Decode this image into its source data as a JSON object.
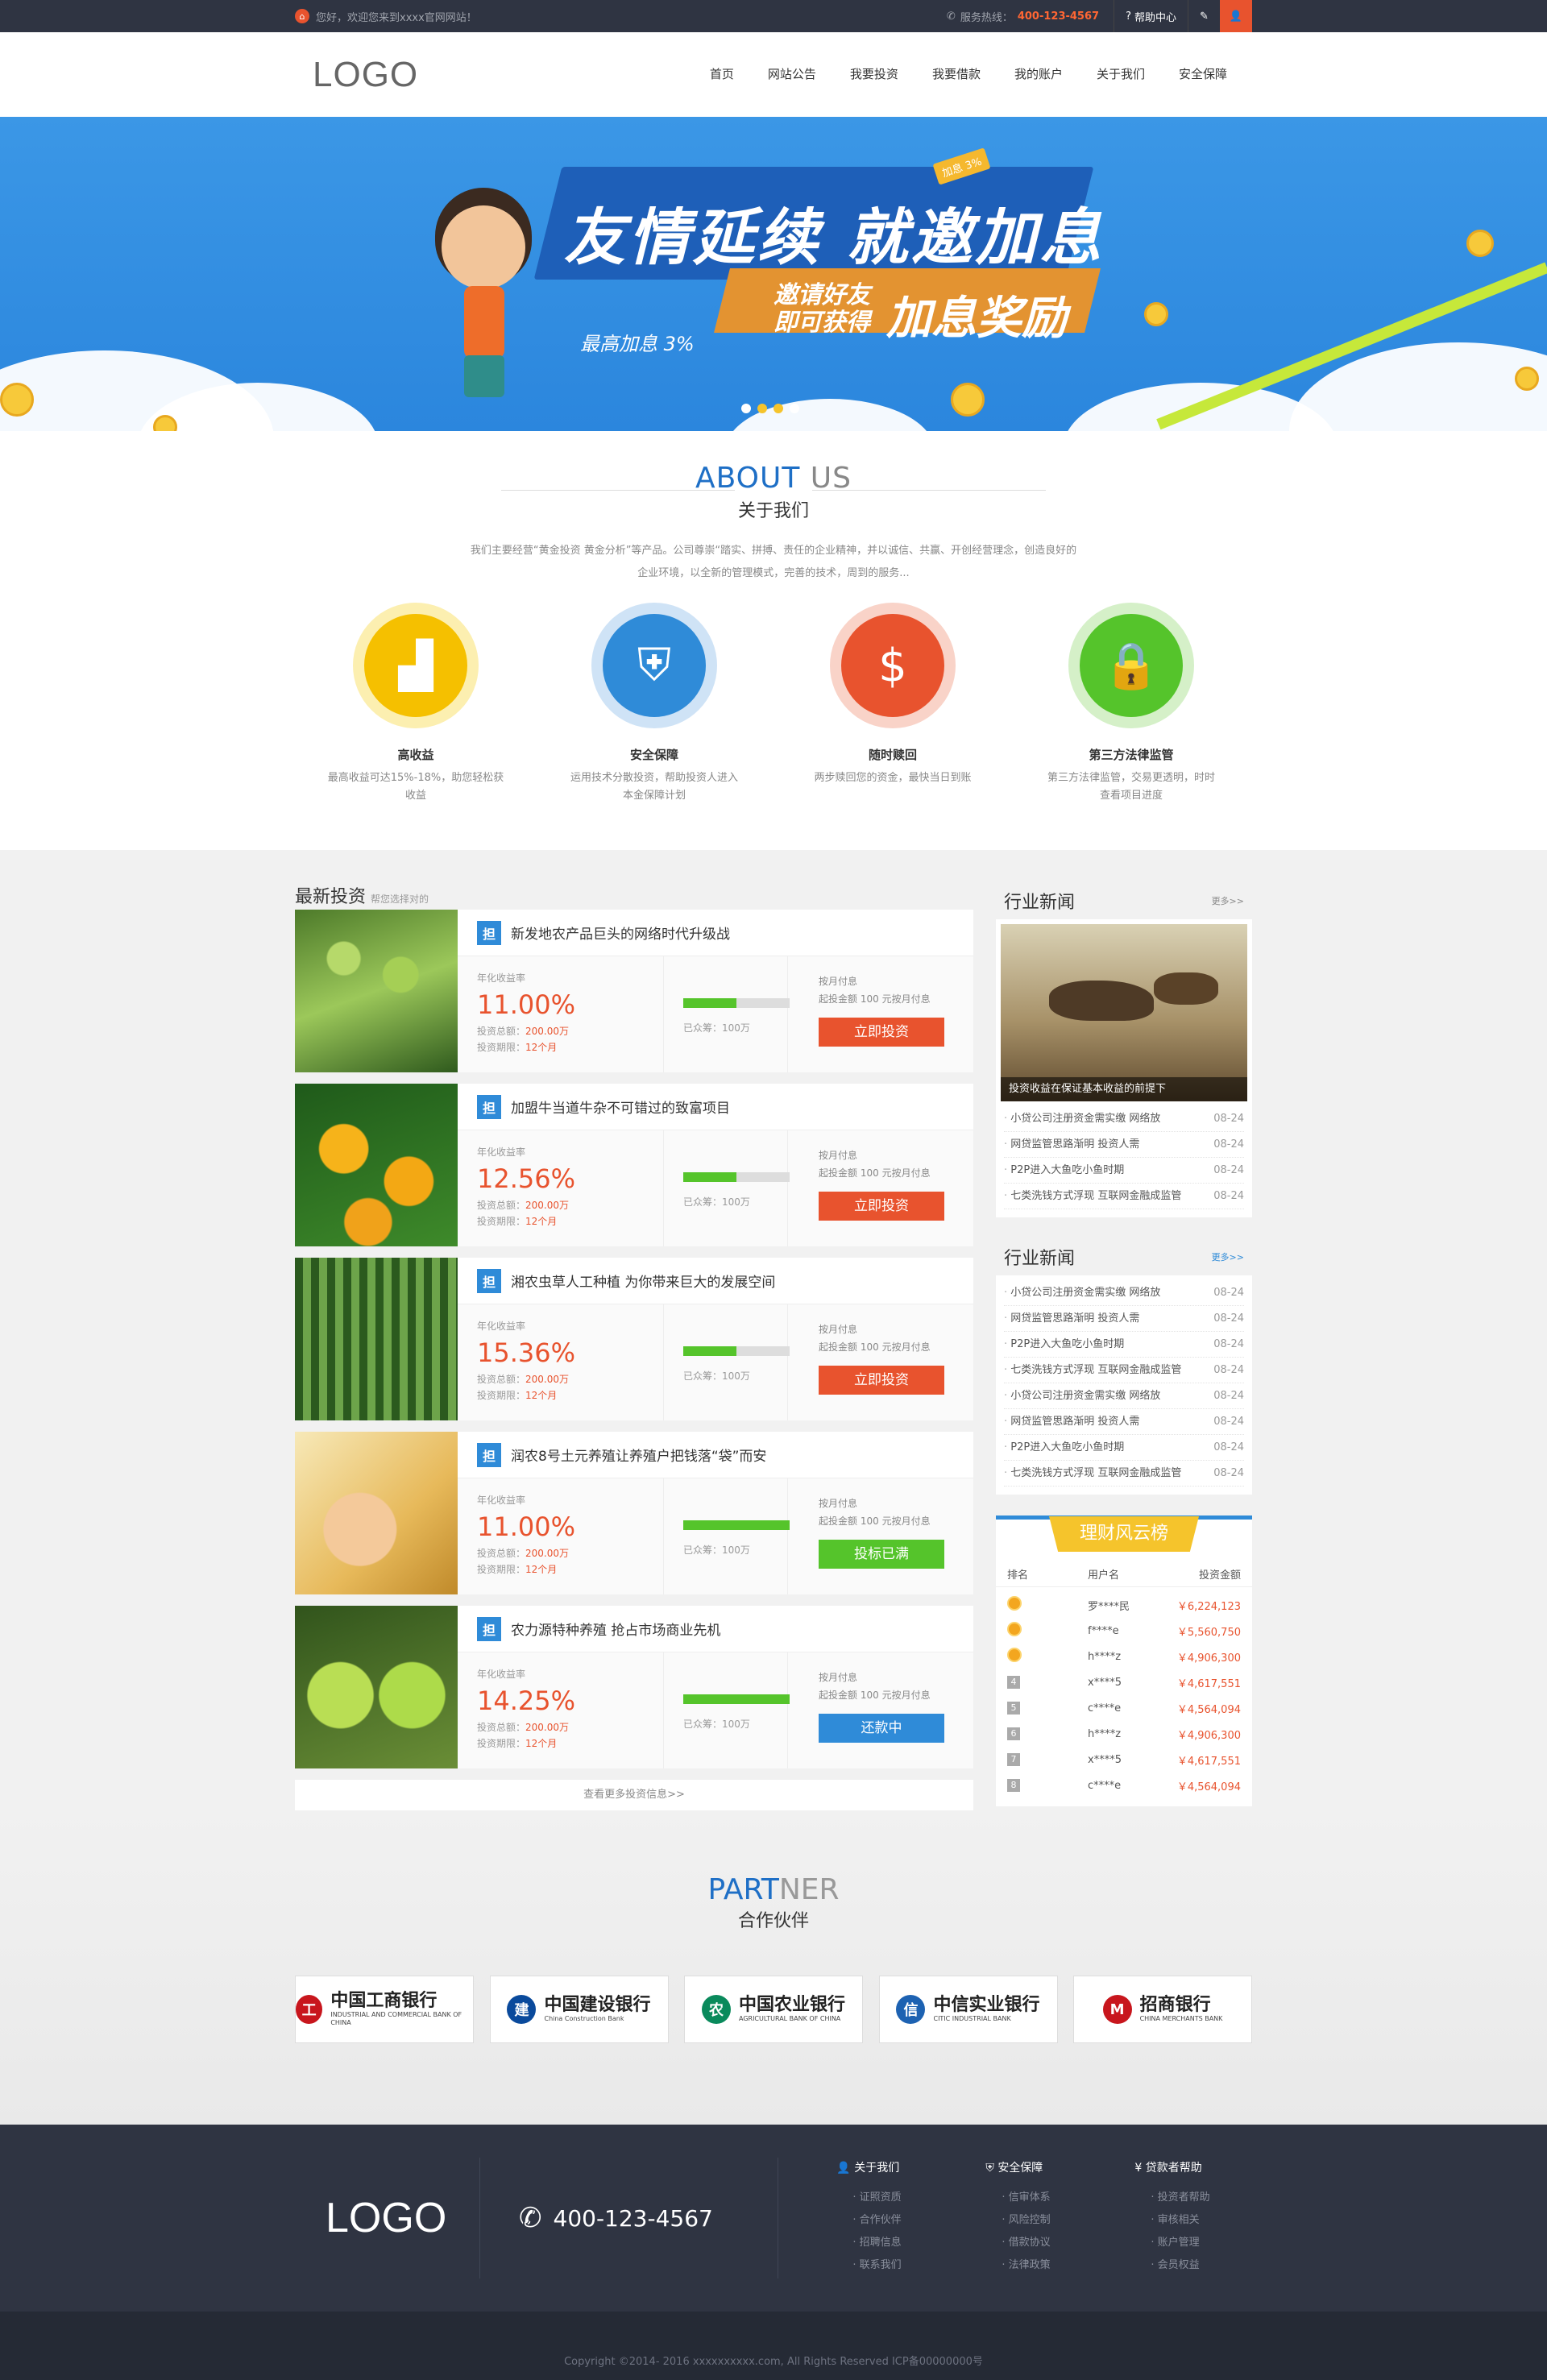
{
  "topbar": {
    "welcome": "您好，欢迎您来到xxxx官网网站！",
    "hotline_label": "服务热线：",
    "hotline": "400-123-4567",
    "help": "帮助中心"
  },
  "header": {
    "logo": "LOGO",
    "nav": [
      "首页",
      "网站公告",
      "我要投资",
      "我要借款",
      "我的账户",
      "关于我们",
      "安全保障"
    ]
  },
  "banner": {
    "tag": "加息 3%",
    "headline": "友情延续 就邀加息",
    "rate": "最高加息 3%",
    "invite": "邀请好友\n即可获得",
    "reward": "加息奖励",
    "slides": 4,
    "active_slide": 2
  },
  "about": {
    "en_a": "ABOUT",
    "en_b": " US",
    "cn": "关于我们",
    "desc": "我们主要经营“黄金投资 黄金分析”等产品。公司尊崇“踏实、拼搏、责任的企业精神，并以诚信、共赢、开创经营理念，创造良好的企业环境，以全新的管理模式，完善的技术，周到的服务...",
    "features": [
      {
        "title": "高收益",
        "desc": "最高收益可达15%-18%，助您轻松获收益",
        "color": "#f5c000",
        "ring": "#fcefb0",
        "icon": "chart-icon"
      },
      {
        "title": "安全保障",
        "desc": "运用技术分散投资，帮助投资人进入本金保障计划",
        "color": "#2f8bd8",
        "ring": "#cfe3f6",
        "icon": "shield-icon"
      },
      {
        "title": "随时赎回",
        "desc": "两步赎回您的资金，最快当日到账",
        "color": "#e8532e",
        "ring": "#f9d3c8",
        "icon": "moneybag-icon"
      },
      {
        "title": "第三方法律监管",
        "desc": "第三方法律监管，交易更透明，时时查看项目进度",
        "color": "#55c42b",
        "ring": "#d5f0c8",
        "icon": "lock-icon"
      }
    ]
  },
  "invest": {
    "title": "最新投资",
    "subtitle": "帮您选择对的",
    "rate_label": "年化收益率",
    "total_label": "投资总额：",
    "term_label": "投资期限：",
    "raised_label": "已众筹：",
    "repay_label": "按月付息",
    "start_label": "起投金额",
    "start_value": "100",
    "start_suffix": "元按月付息",
    "items": [
      {
        "badge": "担",
        "title": "新发地农产品巨头的网络时代升级战",
        "rate": "11.00%",
        "total": "200.00万",
        "term": "12个月",
        "raised": "100万",
        "progress": 0.5,
        "button": "立即投资",
        "state": "open",
        "img": "grapes"
      },
      {
        "badge": "担",
        "title": "加盟牛当道牛杂不可错过的致富项目",
        "rate": "12.56%",
        "total": "200.00万",
        "term": "12个月",
        "raised": "100万",
        "progress": 0.5,
        "button": "立即投资",
        "state": "open",
        "img": "oranges"
      },
      {
        "badge": "担",
        "title": "湘农虫草人工种植 为你带来巨大的发展空间",
        "rate": "15.36%",
        "total": "200.00万",
        "term": "12个月",
        "raised": "100万",
        "progress": 0.5,
        "button": "立即投资",
        "state": "open",
        "img": "greenhouse"
      },
      {
        "badge": "担",
        "title": "润农8号土元养殖让养殖户把钱落“袋”而安",
        "rate": "11.00%",
        "total": "200.00万",
        "term": "12个月",
        "raised": "100万",
        "progress": 1.0,
        "button": "投标已满",
        "state": "full",
        "img": "wheat"
      },
      {
        "badge": "担",
        "title": "农力源特种养殖 抢占市场商业先机",
        "rate": "14.25%",
        "total": "200.00万",
        "term": "12个月",
        "raised": "100万",
        "progress": 1.0,
        "button": "还款中",
        "state": "repay",
        "img": "tomatoes"
      }
    ],
    "more": "查看更多投资信息>>"
  },
  "news1": {
    "title": "行业新闻",
    "more": "更多>>",
    "caption": "投资收益在保证基本收益的前提下",
    "items": [
      {
        "text": "小贷公司注册资金需实缴 网络放",
        "date": "08-24"
      },
      {
        "text": "网贷监管思路渐明 投资人需",
        "date": "08-24"
      },
      {
        "text": "P2P进入大鱼吃小鱼时期",
        "date": "08-24"
      },
      {
        "text": "七类洗钱方式浮现 互联网金融成监管",
        "date": "08-24"
      }
    ]
  },
  "news2": {
    "title": "行业新闻",
    "more": "更多>>",
    "items": [
      {
        "text": "小贷公司注册资金需实缴 网络放",
        "date": "08-24"
      },
      {
        "text": "网贷监管思路渐明 投资人需",
        "date": "08-24"
      },
      {
        "text": "P2P进入大鱼吃小鱼时期",
        "date": "08-24"
      },
      {
        "text": "七类洗钱方式浮现 互联网金融成监管",
        "date": "08-24"
      },
      {
        "text": "小贷公司注册资金需实缴 网络放",
        "date": "08-24"
      },
      {
        "text": "网贷监管思路渐明 投资人需",
        "date": "08-24"
      },
      {
        "text": "P2P进入大鱼吃小鱼时期",
        "date": "08-24"
      },
      {
        "text": "七类洗钱方式浮现 互联网金融成监管",
        "date": "08-24"
      }
    ]
  },
  "rank": {
    "title": "理财风云榜",
    "headers": [
      "排名",
      "用户名",
      "投资金额"
    ],
    "rows": [
      {
        "no": "1",
        "user": "罗****民",
        "amount": "￥6,224,123"
      },
      {
        "no": "2",
        "user": "f****e",
        "amount": "￥5,560,750"
      },
      {
        "no": "3",
        "user": "h****z",
        "amount": "￥4,906,300"
      },
      {
        "no": "4",
        "user": "x****5",
        "amount": "￥4,617,551"
      },
      {
        "no": "5",
        "user": "c****e",
        "amount": "￥4,564,094"
      },
      {
        "no": "6",
        "user": "h****z",
        "amount": "￥4,906,300"
      },
      {
        "no": "7",
        "user": "x****5",
        "amount": "￥4,617,551"
      },
      {
        "no": "8",
        "user": "c****e",
        "amount": "￥4,564,094"
      }
    ]
  },
  "partner": {
    "en_a": "PART",
    "en_b": "NER",
    "cn": "合作伙伴",
    "banks": [
      {
        "name": "中国工商银行",
        "en": "INDUSTRIAL AND COMMERCIAL BANK OF CHINA",
        "color": "#c8161d",
        "mark": "工"
      },
      {
        "name": "中国建设银行",
        "en": "China Construction Bank",
        "color": "#0a4a9c",
        "mark": "建"
      },
      {
        "name": "中国农业银行",
        "en": "AGRICULTURAL BANK OF CHINA",
        "color": "#0a8a5c",
        "mark": "农"
      },
      {
        "name": "中信实业银行",
        "en": "CITIC INDUSTRIAL BANK",
        "color": "#1d62b2",
        "mark": "信"
      },
      {
        "name": "招商银行",
        "en": "CHINA MERCHANTS BANK",
        "color": "#c8161d",
        "mark": "M"
      }
    ]
  },
  "footer": {
    "logo": "LOGO",
    "tel": "400-123-4567",
    "cols": [
      {
        "title": "关于我们",
        "icon": "user-icon",
        "links": [
          "证照资质",
          "合作伙伴",
          "招聘信息",
          "联系我们"
        ]
      },
      {
        "title": "安全保障",
        "icon": "shield-icon",
        "links": [
          "信审体系",
          "风险控制",
          "借款协议",
          "法律政策"
        ]
      },
      {
        "title": "贷款者帮助",
        "icon": "yen-icon",
        "links": [
          "投资者帮助",
          "审核相关",
          "账户管理",
          "会员权益"
        ]
      }
    ],
    "copyright": "Copyright ©2014- 2016 xxxxxxxxxx.com, All Rights Reserved ICP备00000000号"
  }
}
